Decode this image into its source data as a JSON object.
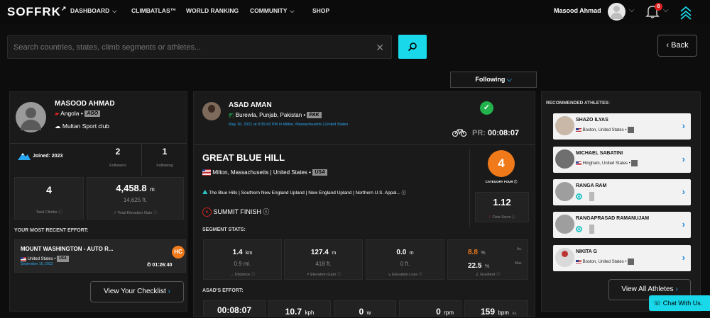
{
  "brand": "SOFFRK",
  "nav": {
    "dashboard": "DASHBOARD",
    "climbatlas": "CLIMBATLAS™",
    "world_ranking": "WORLD RANKING",
    "community": "COMMUNITY",
    "shop": "SHOP"
  },
  "user": {
    "name": "Masood Ahmad",
    "notif_count": "8"
  },
  "search": {
    "placeholder": "Search countries, states, climb segments or athletes..."
  },
  "back_label": "Back",
  "following_label": "Following",
  "profile": {
    "name": "MASOOD AHMAD",
    "country": "Angola",
    "country_code": "AGO",
    "club": "Multan Sport club",
    "joined": "Joined: 2023",
    "followers": "2",
    "followers_label": "Followers",
    "following": "1",
    "following_label": "Following",
    "total_climbs": "4",
    "total_climbs_label": "Total Climbs",
    "elev_m": "4,458.8",
    "elev_m_unit": "m",
    "elev_ft": "14,625",
    "elev_ft_unit": "ft.",
    "elev_label": "Total Elevation Gain"
  },
  "recent": {
    "header": "YOUR MOST RECENT EFFORT:",
    "title": "MOUNT WASHINGTON - AUTO R...",
    "location": "United States",
    "code": "USA",
    "date": "September 16, 2023",
    "badge": "HC",
    "time": "01:26:40",
    "checklist_label": "View Your Checklist"
  },
  "effort": {
    "athlete": "ASAD AMAN",
    "location": "Burewla, Punjab, Pakistan",
    "code": "PAK",
    "timestamp": "May 16, 2021 at 9:39:43 PM in Milton, Massachusetts | United States",
    "pr_label": "PR:",
    "pr_time": "00:08:07",
    "segment": "GREAT BLUE HILL",
    "seg_location": "Milton, Massachusetts | United States",
    "seg_code": "USA",
    "regions": "The Blue Hills | Southern New England Upland | New England Upland | Northern U.S. Appal...",
    "finish": "SUMMIT FINISH",
    "category": "4",
    "category_label": "CATEGORY FOUR",
    "fiets": "1.12",
    "fiets_label": "Fiets Score"
  },
  "segment_stats": {
    "header": "SEGMENT STATS:",
    "distance_km": "1.4",
    "distance_km_unit": "km",
    "distance_mi": "0.9",
    "distance_mi_unit": "mi.",
    "distance_label": "Distance",
    "gain_m": "127.4",
    "gain_m_unit": "m",
    "gain_ft": "418",
    "gain_ft_unit": "ft.",
    "gain_label": "Elevation Gain",
    "loss_m": "0.0",
    "loss_m_unit": "m",
    "loss_ft": "0",
    "loss_ft_unit": "ft.",
    "loss_label": "Elevation Loss",
    "grade_avg": "8.8",
    "grade_avg_unit": "%",
    "grade_avg_tag": "Av.",
    "grade_max": "22.5",
    "grade_max_unit": "%",
    "grade_max_tag": "Max.",
    "grade_label": "Gradient"
  },
  "asad_effort": {
    "header": "ASAD'S EFFORT:",
    "time": "00:08:07",
    "speed": "10.7",
    "speed_unit": "kph",
    "power": "0",
    "power_unit": "w",
    "cadence": "0",
    "cadence_unit": "rpm",
    "hr": "159",
    "hr_unit": "bpm",
    "hr_tag": "Av."
  },
  "recommended": {
    "header": "RECOMMENDED ATHLETES:",
    "athletes": [
      {
        "name": "SHAZO ILYAS",
        "location": "Boston, United States"
      },
      {
        "name": "MICHAEL SABATINI",
        "location": "Hingham, United States"
      },
      {
        "name": "RANGA RAM",
        "location": ""
      },
      {
        "name": "RANGAPRASAD RAMANUJAM",
        "location": ""
      },
      {
        "name": "NIKITA G",
        "location": "Boston, United States"
      }
    ],
    "view_all": "View All Athletes"
  },
  "chat_label": "Chat With Us.",
  "colors": {
    "accent": "#19d8ea",
    "orange": "#f07a1a",
    "green": "#22b24c",
    "link": "#29a6f0"
  }
}
